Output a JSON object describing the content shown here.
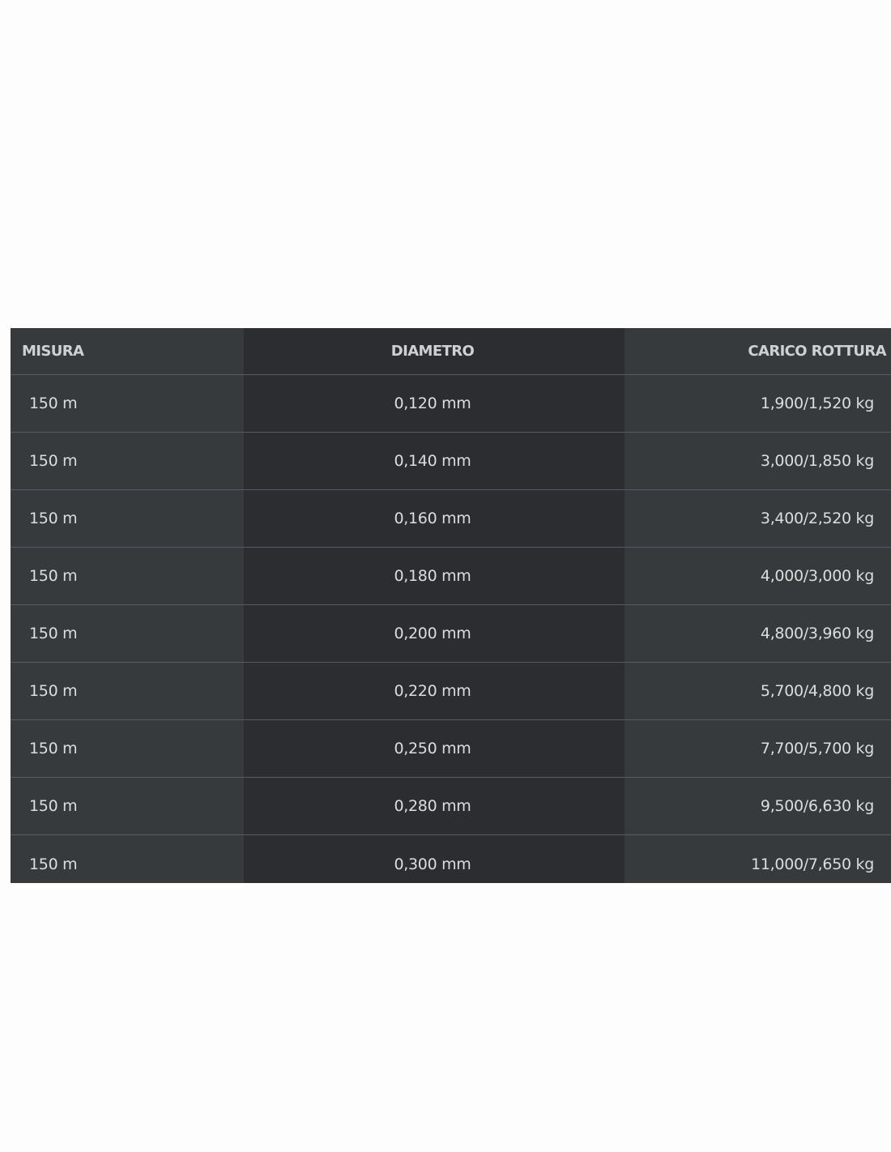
{
  "table": {
    "headers": [
      "MISURA",
      "DIAMETRO",
      "CARICO ROTTURA"
    ],
    "rows": [
      [
        "150 m",
        "0,120 mm",
        "1,900/1,520 kg"
      ],
      [
        "150 m",
        "0,140 mm",
        "3,000/1,850 kg"
      ],
      [
        "150 m",
        "0,160 mm",
        "3,400/2,520 kg"
      ],
      [
        "150 m",
        "0,180 mm",
        "4,000/3,000 kg"
      ],
      [
        "150 m",
        "0,200 mm",
        "4,800/3,960 kg"
      ],
      [
        "150 m",
        "0,220 mm",
        "5,700/4,800 kg"
      ],
      [
        "150 m",
        "0,250 mm",
        "7,700/5,700 kg"
      ],
      [
        "150 m",
        "0,280 mm",
        "9,500/6,630 kg"
      ],
      [
        "150 m",
        "0,300 mm",
        "11,000/7,650 kg"
      ]
    ]
  }
}
